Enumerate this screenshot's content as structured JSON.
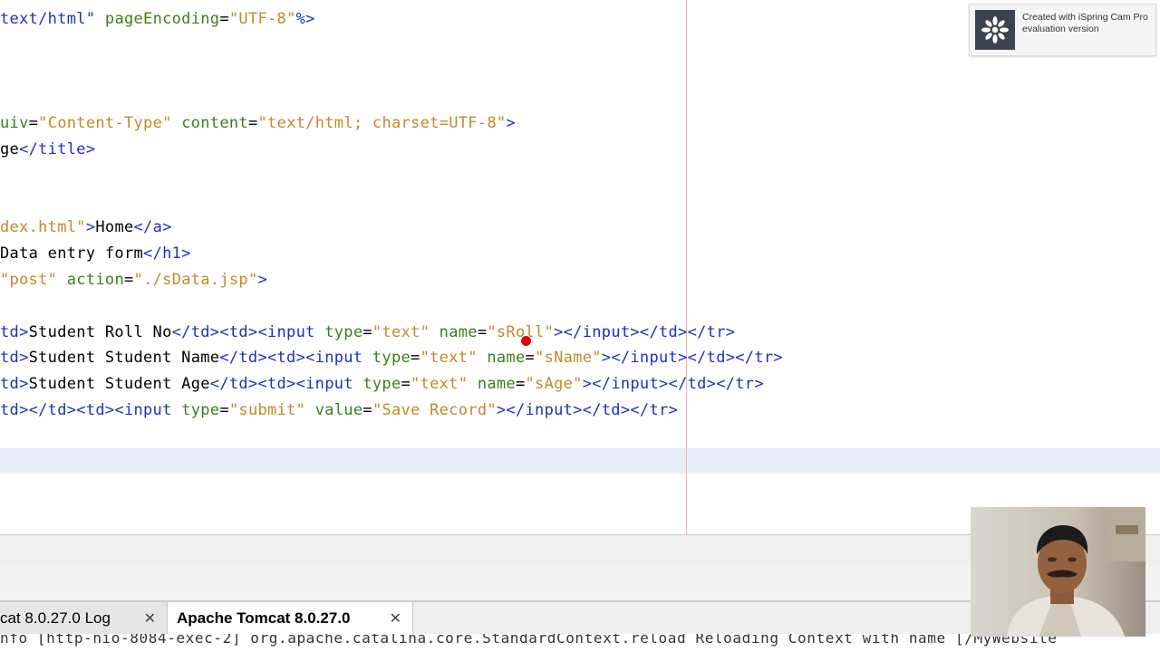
{
  "editor": {
    "lines": [
      {
        "parts": [
          {
            "c": "k",
            "t": "text/html\""
          },
          {
            "c": "t",
            "t": " "
          },
          {
            "c": "a",
            "t": "pageEncoding"
          },
          {
            "c": "t",
            "t": "="
          },
          {
            "c": "s",
            "t": "\"UTF-8\""
          },
          {
            "c": "k",
            "t": "%>"
          }
        ]
      },
      {
        "parts": [
          {
            "c": "a",
            "t": "uiv"
          },
          {
            "c": "t",
            "t": "="
          },
          {
            "c": "s",
            "t": "\"Content-Type\""
          },
          {
            "c": "t",
            "t": " "
          },
          {
            "c": "a",
            "t": "content"
          },
          {
            "c": "t",
            "t": "="
          },
          {
            "c": "s",
            "t": "\"text/html; charset=UTF-8\""
          },
          {
            "c": "k",
            "t": ">"
          }
        ]
      },
      {
        "parts": [
          {
            "c": "t",
            "t": "ge"
          },
          {
            "c": "k",
            "t": "</title>"
          }
        ]
      },
      {
        "parts": [
          {
            "c": "s",
            "t": "dex.html\""
          },
          {
            "c": "k",
            "t": ">"
          },
          {
            "c": "t",
            "t": "Home"
          },
          {
            "c": "k",
            "t": "</a>"
          }
        ]
      },
      {
        "parts": [
          {
            "c": "t",
            "t": "Data entry form"
          },
          {
            "c": "k",
            "t": "</h1>"
          }
        ]
      },
      {
        "parts": [
          {
            "c": "s",
            "t": "\"post\""
          },
          {
            "c": "t",
            "t": " "
          },
          {
            "c": "a",
            "t": "action"
          },
          {
            "c": "t",
            "t": "="
          },
          {
            "c": "s",
            "t": "\"./sData.jsp\""
          },
          {
            "c": "k",
            "t": ">"
          }
        ]
      },
      {
        "parts": [
          {
            "c": "k",
            "t": "td>"
          },
          {
            "c": "t",
            "t": "Student Roll No"
          },
          {
            "c": "k",
            "t": "</td><td><input"
          },
          {
            "c": "t",
            "t": " "
          },
          {
            "c": "a",
            "t": "type"
          },
          {
            "c": "t",
            "t": "="
          },
          {
            "c": "s",
            "t": "\"text\""
          },
          {
            "c": "t",
            "t": " "
          },
          {
            "c": "a",
            "t": "name"
          },
          {
            "c": "t",
            "t": "="
          },
          {
            "c": "s",
            "t": "\"sRoll\""
          },
          {
            "c": "k",
            "t": "></input></td></tr>"
          }
        ]
      },
      {
        "parts": [
          {
            "c": "k",
            "t": "td>"
          },
          {
            "c": "t",
            "t": "Student Student Name"
          },
          {
            "c": "k",
            "t": "</td><td><input"
          },
          {
            "c": "t",
            "t": " "
          },
          {
            "c": "a",
            "t": "type"
          },
          {
            "c": "t",
            "t": "="
          },
          {
            "c": "s",
            "t": "\"text\""
          },
          {
            "c": "t",
            "t": " "
          },
          {
            "c": "a",
            "t": "name"
          },
          {
            "c": "t",
            "t": "="
          },
          {
            "c": "s",
            "t": "\"sName\""
          },
          {
            "c": "k",
            "t": "></input></td></tr>"
          }
        ]
      },
      {
        "parts": [
          {
            "c": "k",
            "t": "td>"
          },
          {
            "c": "t",
            "t": "Student Student Age"
          },
          {
            "c": "k",
            "t": "</td><td><input"
          },
          {
            "c": "t",
            "t": " "
          },
          {
            "c": "a",
            "t": "type"
          },
          {
            "c": "t",
            "t": "="
          },
          {
            "c": "s",
            "t": "\"text\""
          },
          {
            "c": "t",
            "t": " "
          },
          {
            "c": "a",
            "t": "name"
          },
          {
            "c": "t",
            "t": "="
          },
          {
            "c": "s",
            "t": "\"sAge\""
          },
          {
            "c": "k",
            "t": "></input></td></tr>"
          }
        ]
      },
      {
        "parts": [
          {
            "c": "k",
            "t": "td></td><td><input"
          },
          {
            "c": "t",
            "t": " "
          },
          {
            "c": "a",
            "t": "type"
          },
          {
            "c": "t",
            "t": "="
          },
          {
            "c": "s",
            "t": "\"submit\""
          },
          {
            "c": "t",
            "t": " "
          },
          {
            "c": "a",
            "t": "value"
          },
          {
            "c": "t",
            "t": "="
          },
          {
            "c": "s",
            "t": "\"Save Record\""
          },
          {
            "c": "k",
            "t": "></input></td></tr>"
          }
        ]
      }
    ]
  },
  "tabs": {
    "log_label": "cat 8.0.27.0 Log",
    "server_label": "Apache Tomcat 8.0.27.0",
    "close_glyph": "✕"
  },
  "output": {
    "partial_line": "nfo [http-nio-8084-exec-2] org.apache.catalina.core.StandardContext.reload Reloading Context with name [/MyWebsite"
  },
  "watermark": {
    "line1": "Created with iSpring Cam Pro",
    "line2": "evaluation version"
  },
  "colors": {
    "tag": "#1f2fbf",
    "attribute": "#3a7f1a",
    "string": "#c08a2c",
    "margin_line": "#f4b4b4",
    "cursor_marker": "#e00000"
  }
}
